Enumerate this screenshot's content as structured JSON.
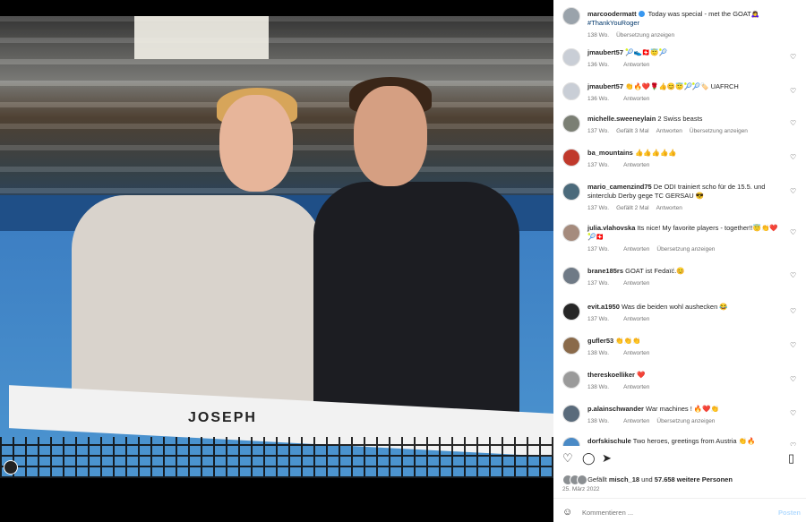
{
  "photo": {
    "net_brand": "JOSEPH"
  },
  "post": {
    "username": "marcoodermatt",
    "caption": "Today was special - met the GOAT🙇‍♀️",
    "hashtag": "#ThankYouRoger",
    "age": "138 Wo.",
    "translate": "Übersetzung anzeigen"
  },
  "comments": [
    {
      "user": "jmaubert57",
      "text": "🎾👟🇨🇭😇🎾",
      "age": "136 Wo.",
      "likes": "",
      "reply": "Antworten",
      "translate": ""
    },
    {
      "user": "jmaubert57",
      "text": "👏🔥❤️🌹👍😊😇🎾🎾🏷️ UAFRCH",
      "age": "136 Wo.",
      "likes": "",
      "reply": "Antworten",
      "translate": ""
    },
    {
      "user": "michelle.sweeneylain",
      "text": "2 Swiss beasts",
      "age": "137 Wo.",
      "likes": "Gefällt 3 Mal",
      "reply": "Antworten",
      "translate": "Übersetzung anzeigen"
    },
    {
      "user": "ba_mountains",
      "text": "👍👍👍👍👍",
      "age": "137 Wo.",
      "likes": "",
      "reply": "Antworten",
      "translate": ""
    },
    {
      "user": "mario_camenzind75",
      "text": "De ODI trainiert scho für de 15.5. und sinterclub Derby gege TC GERSAU 😎",
      "age": "137 Wo.",
      "likes": "Gefällt 2 Mal",
      "reply": "Antworten",
      "translate": ""
    },
    {
      "user": "julia.vlahovska",
      "text": "Its nice! My favorite players - together!!😇👏❤️🎾🇨🇭",
      "age": "137 Wo.",
      "likes": "",
      "reply": "Antworten",
      "translate": "Übersetzung anzeigen"
    },
    {
      "user": "brane185rs",
      "text": "GOAT ist Fedaïć.😊",
      "age": "137 Wo.",
      "likes": "",
      "reply": "Antworten",
      "translate": ""
    },
    {
      "user": "evit.a1950",
      "text": "Was die beiden wohl aushecken 😂",
      "age": "137 Wo.",
      "likes": "",
      "reply": "Antworten",
      "translate": ""
    },
    {
      "user": "gufler53",
      "text": "👏👏👏",
      "age": "138 Wo.",
      "likes": "",
      "reply": "Antworten",
      "translate": ""
    },
    {
      "user": "thereskoelliker",
      "text": "❤️",
      "age": "138 Wo.",
      "likes": "",
      "reply": "Antworten",
      "translate": ""
    },
    {
      "user": "p.alainschwander",
      "text": "War machines ! 🔥❤️👏",
      "age": "138 Wo.",
      "likes": "",
      "reply": "Antworten",
      "translate": "Übersetzung anzeigen"
    },
    {
      "user": "dorfskischule",
      "text": "Two heroes, greetings from Austria 👏🔥",
      "age": "",
      "likes": "",
      "reply": "",
      "translate": ""
    }
  ],
  "likes_line": {
    "prefix": "Gefällt",
    "user": "misch_18",
    "middle": "und",
    "count": "57.658 weitere Personen"
  },
  "date": "25. März 2022",
  "compose": {
    "placeholder": "Kommentieren ...",
    "post_label": "Posten"
  }
}
